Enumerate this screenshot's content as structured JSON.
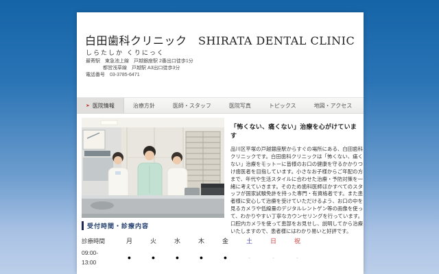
{
  "background": {
    "top_color": "#1464a7",
    "bottom_color": "#bccfea"
  },
  "header": {
    "title": "白田歯科クリニック　SHIRATA DENTAL CLINIC",
    "subtitle": "しらたしか くりにっく",
    "address_lines": [
      "最寄駅　東急池上線　戸越銀座駅 2番出口徒歩1分",
      "都営浅草線　戸越駅 A3出口徒歩3分",
      "電話番号　03-3785-6471"
    ]
  },
  "nav": {
    "items": [
      {
        "label": "医院情報",
        "active": true
      },
      {
        "label": "治療方針",
        "active": false
      },
      {
        "label": "医師・スタッフ",
        "active": false
      },
      {
        "label": "医院写真",
        "active": false
      },
      {
        "label": "トピックス",
        "active": false
      },
      {
        "label": "地図・アクセス",
        "active": false
      }
    ],
    "active_icon": "red-arrow",
    "active_icon_glyph": "➤"
  },
  "main": {
    "headline": "「怖くない、痛くない」治療を心がけています",
    "paragraph": "品川区平塚の戸越銀座駅からすぐの場所にある、白田歯科クリニックです。白田歯科クリニックは「怖くない、痛くない」治療をモットーに皆様のお口の健康を守るかかりつけ歯医者を目指しています。小さなお子様からご年配の方まで、年代や生活スタイルに合わせた治療・予防対策を一緒に考えていきます。そのため歯科医師ほかすべてのスタッフが国家試験免許を持った専門・有資格者です。また患者様に安心して治療を受けていただけるよう、お口の中を見るカメラや低線量のデジタルレントゲン等の画像を使って、わかりやすい丁寧なカウンセリングを行っています。口腔内カメラを使って患部をお見せし、説明してから治療いたしますので、患者様にはわかり易いと好評です。",
    "photo": "clinic-staff-photo"
  },
  "hours": {
    "section_title": "受付時間・診療内容",
    "table": {
      "time_label": "診療時間",
      "days": [
        "月",
        "火",
        "水",
        "木",
        "金",
        "土",
        "日",
        "祝"
      ],
      "day_colors": [
        "#333333",
        "#333333",
        "#333333",
        "#333333",
        "#333333",
        "#4a4aa8",
        "#cc4444",
        "#cc4444"
      ],
      "rows": [
        {
          "time_line1": "09:00-",
          "time_line2": "13:00",
          "marks": [
            "●",
            "●",
            "●",
            "●",
            "●",
            "-",
            "-",
            "-"
          ]
        }
      ]
    }
  },
  "colors": {
    "accent_navy": "#24406f",
    "nav_active_icon_red": "#c0392b",
    "saturday_blue": "#4a4aa8",
    "sunday_red": "#cc4444"
  }
}
